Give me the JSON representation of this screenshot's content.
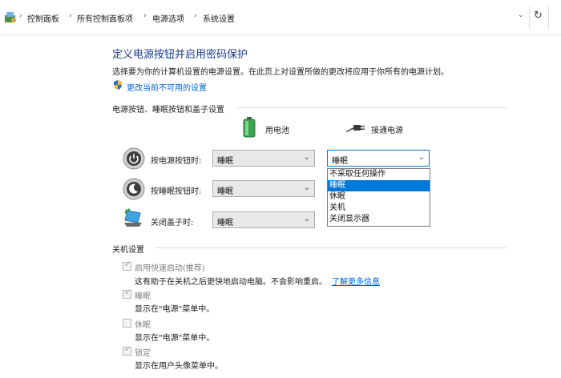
{
  "breadcrumb": [
    "控制面板",
    "所有控制面板项",
    "电源选项",
    "系统设置"
  ],
  "page": {
    "title": "定义电源按钮并启用密码保护",
    "description": "选择要为你的计算机设置的电源设置。在此页上对设置所做的更改将应用于你所有的电源计划。",
    "change_link": "更改当前不可用的设置"
  },
  "buttons_section": {
    "heading": "电源按钮、睡眠按钮和盖子设置",
    "col_battery": "用电池",
    "col_plugged": "接通电源",
    "rows": [
      {
        "label": "按电源按钮时:",
        "battery": "睡眠",
        "plugged": "睡眠"
      },
      {
        "label": "按睡眠按钮时:",
        "battery": "睡眠"
      },
      {
        "label": "关闭盖子时:",
        "battery": "睡眠"
      }
    ],
    "dropdown_options": [
      "不采取任何操作",
      "睡眠",
      "休眠",
      "关机",
      "关闭显示器"
    ],
    "dropdown_selected": "睡眠"
  },
  "shutdown_section": {
    "heading": "关机设置",
    "items": [
      {
        "label": "启用快速启动(推荐)",
        "checked": true,
        "desc": "这有助于在关机之后更快地启动电脑。不会影响重启。",
        "link": "了解更多信息"
      },
      {
        "label": "睡眠",
        "checked": true,
        "desc": "显示在\"电源\"菜单中。"
      },
      {
        "label": "休眠",
        "checked": false,
        "desc": "显示在\"电源\"菜单中。"
      },
      {
        "label": "锁定",
        "checked": true,
        "desc": "显示在用户头像菜单中。"
      }
    ]
  },
  "colors": {
    "title": "#1a3b8c",
    "link": "#0066cc",
    "accent": "#0078d7"
  },
  "icons": [
    "control-panel-icon",
    "chevron-down-icon",
    "refresh-icon",
    "shield-icon",
    "battery-icon",
    "plug-icon",
    "power-button-icon",
    "sleep-button-icon",
    "laptop-lid-icon",
    "checkmark-icon"
  ]
}
